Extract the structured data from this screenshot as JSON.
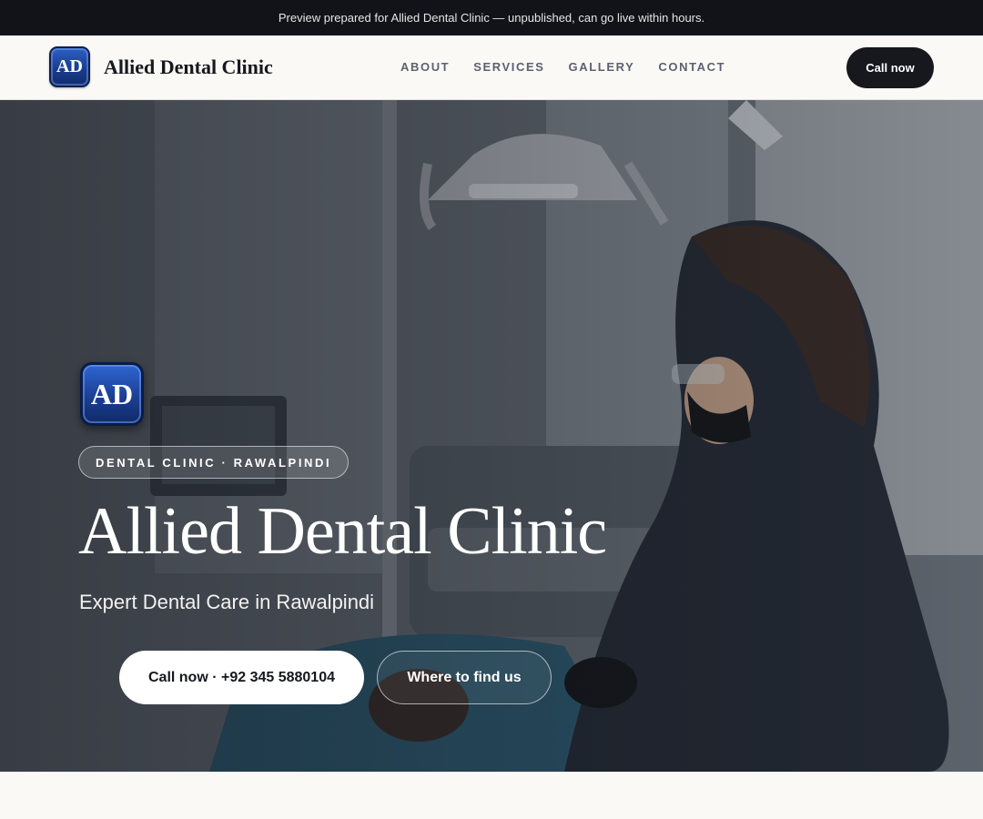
{
  "announcement": {
    "text": "Preview prepared for Allied Dental Clinic — unpublished, can go live within hours."
  },
  "navbar": {
    "logo_initials": "AD",
    "brand_name": "Allied Dental Clinic",
    "links": [
      {
        "label": "ABOUT"
      },
      {
        "label": "SERVICES"
      },
      {
        "label": "GALLERY"
      },
      {
        "label": "CONTACT"
      }
    ],
    "cta_label": "Call now"
  },
  "hero": {
    "logo_initials": "AD",
    "badge": "DENTAL CLINIC · RAWALPINDI",
    "title": "Allied Dental Clinic",
    "subtitle": "Expert Dental Care in Rawalpindi",
    "primary_button": "Call now · +92 345 5880104",
    "secondary_button": "Where to find us"
  },
  "colors": {
    "dark": "#16181d",
    "topbar": "#111318",
    "page_bg": "#faf9f6",
    "logo_blue": "#1b3f94"
  }
}
